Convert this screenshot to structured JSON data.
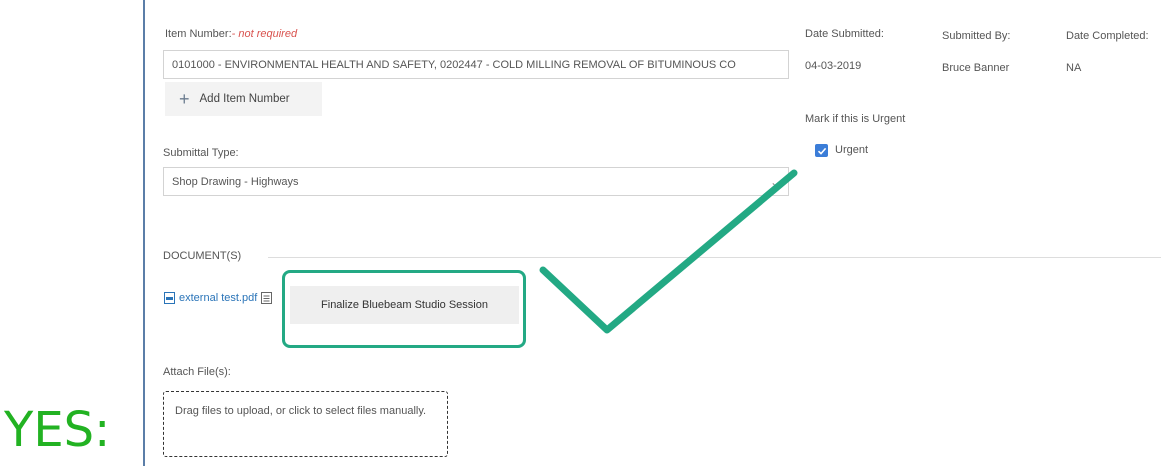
{
  "item_number": {
    "label": "Item Number:",
    "optional_note": "- not required",
    "value": "0101000 - ENVIRONMENTAL HEALTH AND SAFETY, 0202447 - COLD MILLING REMOVAL OF BITUMINOUS CO",
    "add_button_label": "Add Item Number"
  },
  "meta": {
    "date_submitted_label": "Date Submitted:",
    "date_submitted_value": "04-03-2019",
    "submitted_by_label": "Submitted By:",
    "submitted_by_value": "Bruce Banner",
    "date_completed_label": "Date Completed:",
    "date_completed_value": "NA"
  },
  "urgent": {
    "section_label": "Mark if this is Urgent",
    "checkbox_label": "Urgent",
    "checked": true
  },
  "submittal_type": {
    "label": "Submittal Type:",
    "value": "Shop Drawing - Highways"
  },
  "documents": {
    "section_label": "DOCUMENT(S)",
    "file_name": "external test.pdf",
    "finalize_button_label": "Finalize Bluebeam Studio Session"
  },
  "attach": {
    "label": "Attach File(s):",
    "dropzone_text": "Drag files to upload, or click to select files manually."
  },
  "annotation": {
    "verdict": "YES:",
    "highlight_color": "#23a984",
    "verdict_color": "#22b222"
  }
}
